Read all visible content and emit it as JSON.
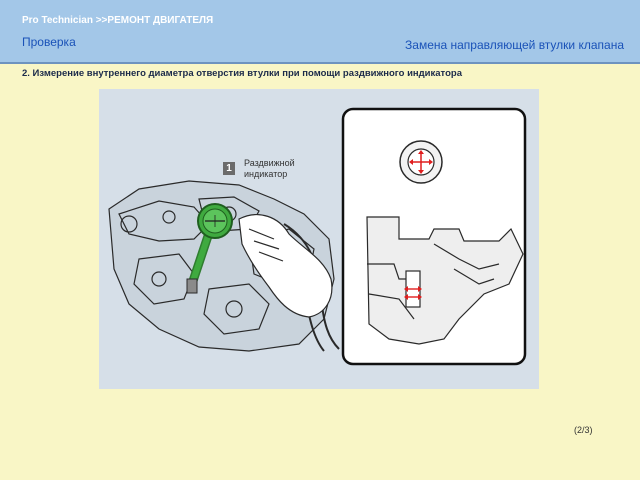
{
  "header": {
    "breadcrumb": "Pro Technician >>РЕМОНТ ДВИГАТЕЛЯ",
    "section": "Проверка",
    "procedure": "Замена направляющей втулки клапана"
  },
  "step": {
    "text": "2. Измерение внутреннего диаметра отверстия втулки при помощи раздвижного индикатора"
  },
  "figure": {
    "callout_number": "1",
    "callout_label": "Раздвижной индикатор"
  },
  "footer": {
    "page": "(2/3)"
  },
  "colors": {
    "header_bg": "#a3c7e8",
    "page_bg": "#f9f6c6",
    "title_blue": "#1a52b8",
    "gauge_green": "#3faa3f",
    "marker_red": "#e01e1e"
  },
  "icons": [
    "dial-gauge-illustration",
    "cylinder-head-illustration",
    "bore-gauge-cross-icon",
    "guide-cross-section-icon"
  ]
}
